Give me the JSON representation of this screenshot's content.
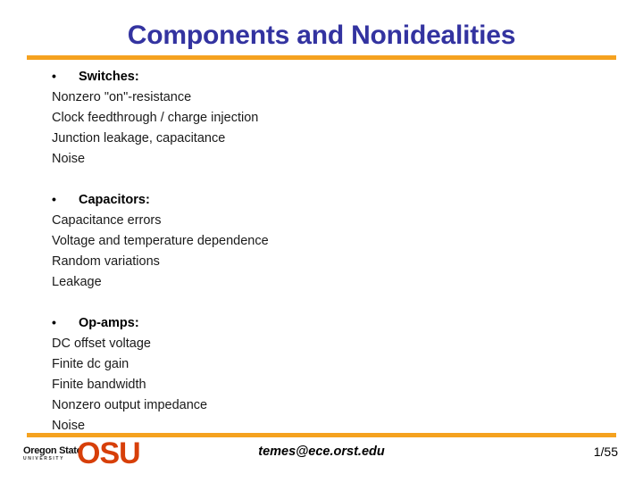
{
  "slide": {
    "title": "Components and Nonidealities",
    "title_color": "#3333A0",
    "rule_color": "#F5A21F",
    "background_color": "#FFFFFF"
  },
  "content": {
    "groups": [
      {
        "bullet": "•",
        "heading": "Switches:",
        "lines": [
          "Nonzero \"on\"-resistance",
          "Clock feedthrough / charge injection",
          "Junction leakage, capacitance",
          "Noise"
        ]
      },
      {
        "bullet": "•",
        "heading": "Capacitors:",
        "lines": [
          "Capacitance errors",
          "Voltage and temperature dependence",
          "Random variations",
          "Leakage"
        ]
      },
      {
        "bullet": "•",
        "heading": "Op-amps:",
        "lines": [
          "DC offset voltage",
          "Finite dc gain",
          "Finite bandwidth",
          "Nonzero output impedance",
          "Noise"
        ]
      }
    ]
  },
  "footer": {
    "logo": {
      "wordmark_line1": "Oregon State",
      "wordmark_line2": "UNIVERSITY",
      "mark": "OSU",
      "mark_color": "#D73F09"
    },
    "email": "temes@ece.orst.edu",
    "page_number": "1/55"
  }
}
